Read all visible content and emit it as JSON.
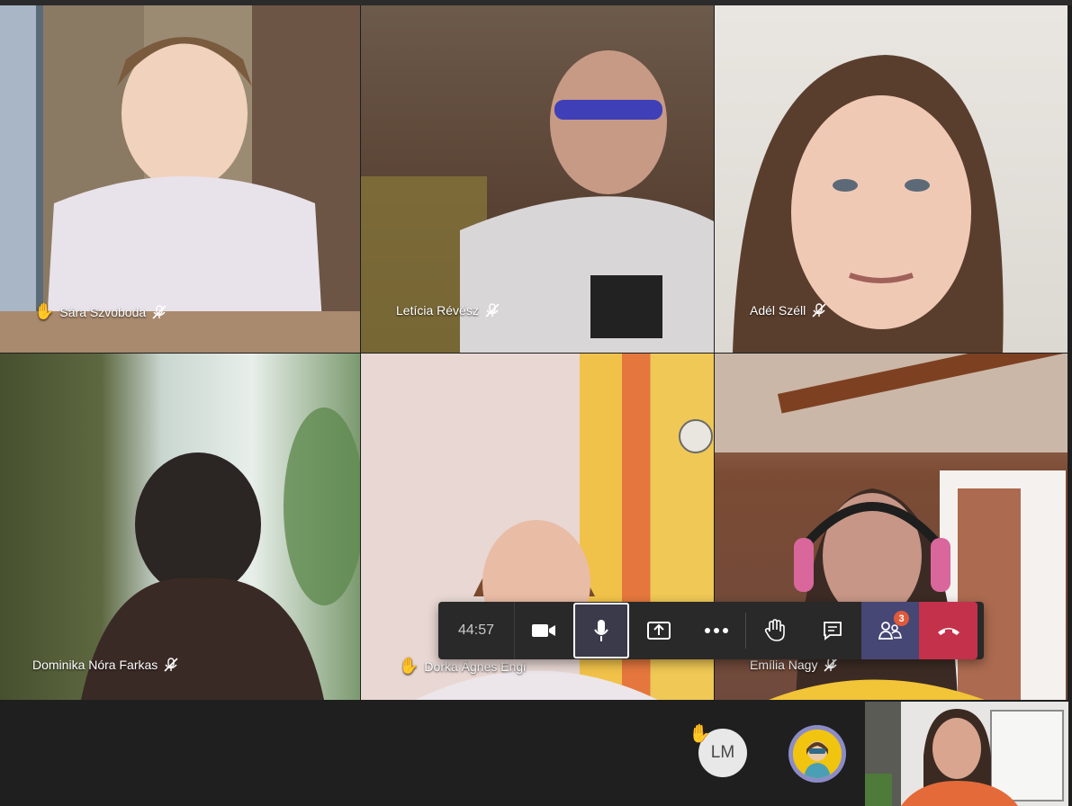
{
  "participants": [
    {
      "name": "Sára Szvoboda",
      "hand_raised": true,
      "muted": true
    },
    {
      "name": "Letícia Révész",
      "hand_raised": false,
      "muted": true
    },
    {
      "name": "Adél Széll",
      "hand_raised": false,
      "muted": true
    },
    {
      "name": "Dominika Nóra Farkas",
      "hand_raised": false,
      "muted": true
    },
    {
      "name": "Dorka Ágnes Engi",
      "hand_raised": true,
      "muted": false
    },
    {
      "name": "Emília Nagy",
      "hand_raised": false,
      "muted": true
    }
  ],
  "controls": {
    "timer": "44:57",
    "people_badge": "3",
    "icons": [
      "camera-icon",
      "microphone-icon",
      "share-screen-icon",
      "more-options-icon",
      "raise-hand-icon",
      "chat-icon",
      "participants-icon",
      "hang-up-icon"
    ]
  },
  "bottom": {
    "avatar_initials": "LM",
    "avatar_hand_raised": true
  },
  "colors": {
    "background": "#1f1f1f",
    "control_bar": "#292929",
    "people_button": "#464775",
    "hangup": "#c4314b",
    "badge": "#e05a3a"
  }
}
